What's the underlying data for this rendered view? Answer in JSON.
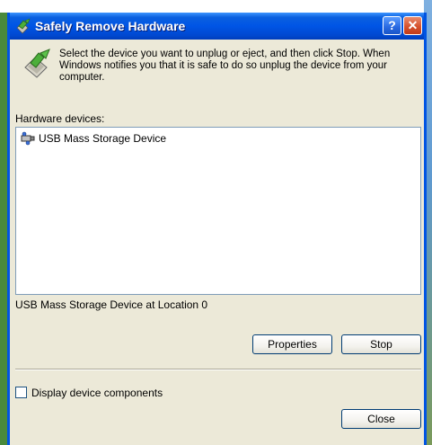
{
  "window": {
    "title": "Safely Remove Hardware",
    "help_button": "?",
    "close_button": "✕"
  },
  "instructions": "Select the device you want to unplug or eject, and then click Stop. When Windows notifies you that it is safe to do so unplug the device from your computer.",
  "hardware_devices_label": "Hardware devices:",
  "devices": [
    {
      "label": "USB Mass Storage Device",
      "icon": "usb-device-icon"
    }
  ],
  "selected_device_location": "USB Mass Storage Device at Location 0",
  "buttons": {
    "properties": "Properties",
    "stop": "Stop",
    "close": "Close"
  },
  "display_components": {
    "label": "Display device components",
    "checked": false
  },
  "colors": {
    "titlebar": "#0055e5",
    "window_bg": "#ece9d8",
    "close_button": "#d6532e"
  }
}
